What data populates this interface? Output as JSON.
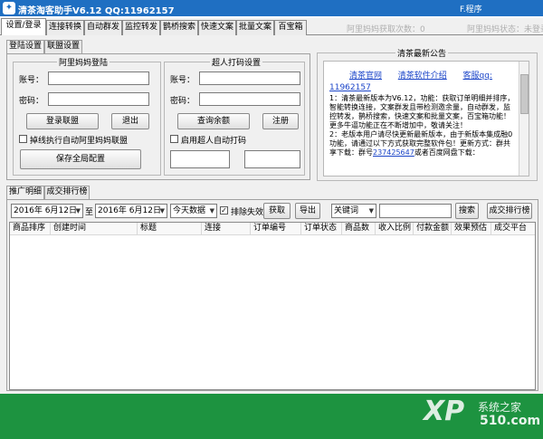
{
  "window": {
    "title": "清茶淘客助手V6.12 QQ:11962157",
    "program_menu": "F.程序"
  },
  "status": {
    "fetch_count": "阿里妈妈获取次数：0",
    "state": "阿里妈妈状态：未登录"
  },
  "main_tabs": [
    "设置/登录",
    "连接转换",
    "自动群发",
    "监控转发",
    "鹊桥搜索",
    "快速文案",
    "批量文案",
    "百宝箱"
  ],
  "sub_tabs": [
    "登陆设置",
    "联盟设置"
  ],
  "alimama": {
    "title": "阿里妈妈登陆",
    "account_label": "账号：",
    "password_label": "密码：",
    "login_btn": "登录联盟",
    "logout_btn": "退出",
    "auto_login_label": "掉线执行自动阿里妈妈联盟",
    "save_btn": "保存全局配置"
  },
  "captcha": {
    "title": "超人打码设置",
    "account_label": "账号：",
    "password_label": "密码：",
    "balance_btn": "查询余额",
    "register_btn": "注册",
    "auto_label": "启用超人自动打码"
  },
  "notice": {
    "title": "清茶最新公告",
    "links": [
      "清茶官网",
      "清茶软件介绍",
      "客服qq:"
    ],
    "qq": "11962157",
    "text1": "1：清茶最新版本为V6.12，功能：获取订单明细并排序，智能转换连接，文案群发且带检测邀余量，自动群发，监控转发，鹊桥搜索，快速文案和批量文案，百宝箱功能！更多牛逼功能正在不断增加中，敬请关注！",
    "text2_pre": "2：老版本用户请尽快更新最新版本，由于新版本集成融0功能，请通过以下方式获取完整软件包！更新方式：群共享下载：群号",
    "text2_group": "237425647",
    "text2_post": "或者百度网盘下载："
  },
  "lower_tabs": [
    "推广明细",
    "成交排行榜"
  ],
  "filters": {
    "date_from": "2016年 6月12日",
    "to_label": "至",
    "date_to": "2016年 6月12日",
    "range": "今天数据",
    "exclude_label": "排除失效",
    "fetch_btn": "获取",
    "export_btn": "导出",
    "keyword_select": "关键词",
    "search_btn": "搜索",
    "rank_btn": "成交排行榜"
  },
  "table": {
    "headers": [
      "商品排序",
      "创建时间",
      "标题",
      "连接",
      "订单编号",
      "订单状态",
      "商品数",
      "收入比例",
      "付款金额",
      "效果预估",
      "成交平台"
    ]
  },
  "footer": {
    "brand": "XP",
    "site": "系统之家",
    "domain": "510.com"
  },
  "colors": {
    "titlebar": "#1f6fc2",
    "footer": "#1d9340",
    "link": "#1a44c8"
  }
}
